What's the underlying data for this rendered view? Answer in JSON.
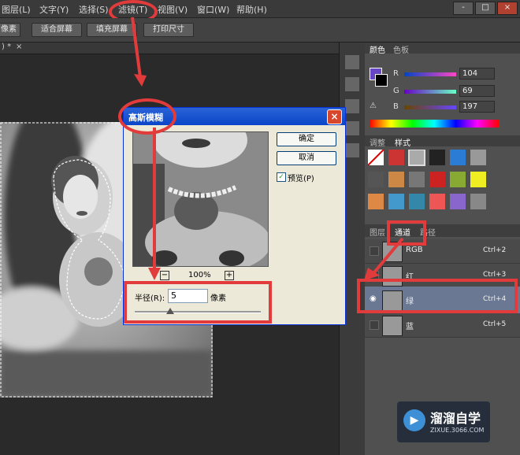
{
  "menu": {
    "items": [
      "图层(L)",
      "文字(Y)",
      "选择(S)",
      "滤镜(T)",
      "视图(V)",
      "窗口(W)",
      "帮助(H)"
    ]
  },
  "window_controls": [
    "-",
    "□",
    "×"
  ],
  "toolbar": {
    "buttons": [
      "像素",
      "适合屏幕",
      "填充屏幕",
      "打印尺寸"
    ]
  },
  "doc_tab": {
    "label": ") *",
    "close": "×"
  },
  "panels": {
    "color_tabs": [
      "颜色",
      "色板"
    ],
    "rgb": [
      {
        "label": "R",
        "value": "104"
      },
      {
        "label": "G",
        "value": "69"
      },
      {
        "label": "B",
        "value": "197"
      }
    ],
    "style_tabs": [
      "调整",
      "样式"
    ],
    "layer_tabs": [
      "图层",
      "通道",
      "路径"
    ],
    "channels": [
      {
        "name": "RGB",
        "shortcut": "Ctrl+2"
      },
      {
        "name": "红",
        "shortcut": "Ctrl+3"
      },
      {
        "name": "绿",
        "shortcut": "Ctrl+4"
      },
      {
        "name": "蓝",
        "shortcut": "Ctrl+5"
      }
    ]
  },
  "dialog": {
    "title": "高斯模糊",
    "ok": "确定",
    "cancel": "取消",
    "preview_label": "预览(P)",
    "zoom": "100%",
    "zoom_out": "−",
    "zoom_in": "+",
    "radius_label": "半径(R):",
    "radius_value": "5",
    "radius_unit": "像素"
  },
  "watermark": {
    "title": "溜溜自学",
    "url": "ZIXUE.3066.COM"
  },
  "colors": {
    "accent_red": "#e23b3b",
    "foreground_swatch": "#6845c5",
    "dialog_title_blue": "#0a46c8"
  }
}
